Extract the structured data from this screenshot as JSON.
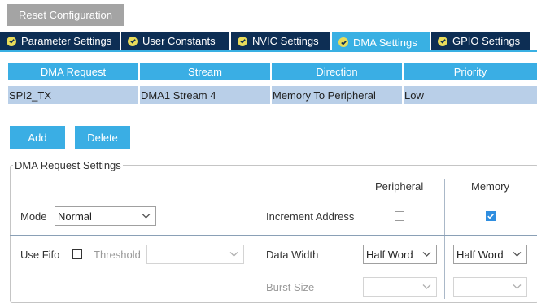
{
  "toolbar": {
    "reset_label": "Reset Configuration"
  },
  "tabs": [
    {
      "label": "Parameter Settings",
      "active": false
    },
    {
      "label": "User Constants",
      "active": false
    },
    {
      "label": "NVIC Settings",
      "active": false
    },
    {
      "label": "DMA Settings",
      "active": true
    },
    {
      "label": "GPIO Settings",
      "active": false
    }
  ],
  "table": {
    "headers": [
      "DMA Request",
      "Stream",
      "Direction",
      "Priority"
    ],
    "rows": [
      [
        "SPI2_TX",
        "DMA1 Stream 4",
        "Memory To Peripheral",
        "Low"
      ]
    ]
  },
  "actions": {
    "add_label": "Add",
    "delete_label": "Delete"
  },
  "settings": {
    "title": "DMA Request Settings",
    "peripheral_header": "Peripheral",
    "memory_header": "Memory",
    "mode_label": "Mode",
    "mode_value": "Normal",
    "increment_address_label": "Increment Address",
    "peripheral_increment_checked": false,
    "memory_increment_checked": true,
    "use_fifo_label": "Use Fifo",
    "use_fifo_checked": false,
    "threshold_label": "Threshold",
    "threshold_value": "",
    "data_width_label": "Data Width",
    "peripheral_data_width": "Half Word",
    "memory_data_width": "Half Word",
    "burst_size_label": "Burst Size",
    "peripheral_burst_size": "",
    "memory_burst_size": ""
  },
  "colors": {
    "accent": "#39b0e3",
    "tab_dark": "#0d2e54",
    "row_selected": "#b9cfe8",
    "check_badge": "#e9dc5a"
  }
}
